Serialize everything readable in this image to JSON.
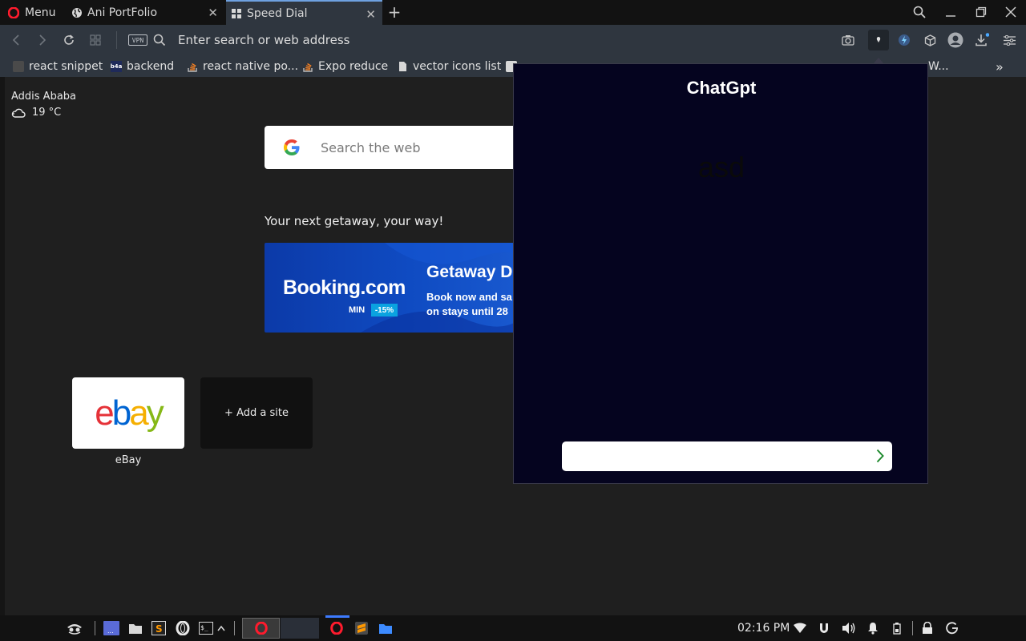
{
  "tabs": {
    "menu_label": "Menu",
    "items": [
      {
        "label": "Ani PortFolio"
      },
      {
        "label": "Speed Dial"
      }
    ]
  },
  "address_bar": {
    "vpn_label": "VPN",
    "placeholder": "Enter search or web address"
  },
  "bookmarks": [
    {
      "label": "react snippet"
    },
    {
      "label": "backend"
    },
    {
      "label": "react native po..."
    },
    {
      "label": "Expo reduce"
    },
    {
      "label": "vector icons list"
    }
  ],
  "bookmarks_overflow_text": "W...",
  "weather": {
    "city": "Addis Ababa",
    "temperature": "19 °C"
  },
  "search": {
    "placeholder": "Search the web"
  },
  "promo": {
    "heading": "Your next getaway, your way!",
    "brand": "Booking.com",
    "min_label": "MIN",
    "discount": "-15%",
    "title": "Getaway D",
    "line1": "Book now and sa",
    "line2": "on stays until 28"
  },
  "speed_dial": {
    "ebay_label": "eBay",
    "ebay_logo": {
      "e": "e",
      "b": "b",
      "a": "a",
      "y": "y"
    },
    "add_site": "+  Add a site"
  },
  "chatgpt_popup": {
    "title": "ChatGpt",
    "message": "asd",
    "input_value": ""
  },
  "taskbar": {
    "clock": "02:16 PM"
  },
  "colors": {
    "popup_bg": "#05041f",
    "tab_active": "#2f363f",
    "send_arrow": "#1f8a2e",
    "ebay_e": "#e53238",
    "ebay_b": "#0064d2",
    "ebay_a": "#f5af02",
    "ebay_y": "#86b817"
  }
}
